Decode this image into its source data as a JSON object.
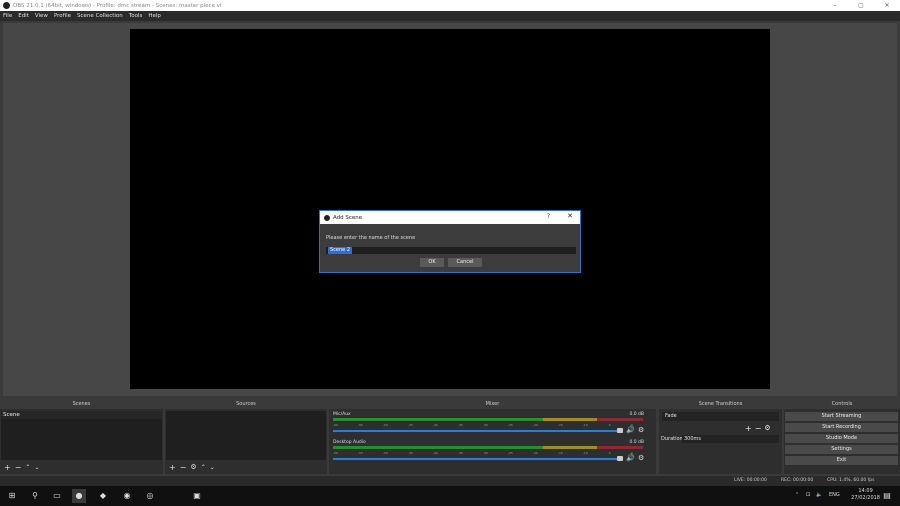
{
  "window": {
    "title": "OBS 21.0.1 (64bit, windows) - Profile: dmc stream - Scenes: master piece vi",
    "min": "–",
    "max": "▢",
    "close": "✕"
  },
  "menu": [
    "File",
    "Edit",
    "View",
    "Profile",
    "Scene Collection",
    "Tools",
    "Help"
  ],
  "dialog": {
    "title": "Add Scene",
    "help": "?",
    "close": "✕",
    "prompt": "Please enter the name of the scene",
    "input_value": "Scene 2",
    "ok": "OK",
    "cancel": "Cancel"
  },
  "docks": {
    "scenes": {
      "header": "Scenes",
      "items": [
        "Scene"
      ]
    },
    "sources": {
      "header": "Sources"
    },
    "mixer": {
      "header": "Mixer",
      "channels": [
        {
          "name": "Mic/Aux",
          "db": "0.0 dB"
        },
        {
          "name": "Desktop Audio",
          "db": "0.0 dB"
        }
      ],
      "ticks": [
        "-60",
        "-55",
        "-50",
        "-45",
        "-40",
        "-35",
        "-30",
        "-25",
        "-20",
        "-15",
        "-10",
        "-5",
        "0"
      ]
    },
    "transitions": {
      "header": "Scene Transitions",
      "selected": "Fade",
      "duration_label": "Duration",
      "duration_value": "300ms"
    },
    "controls": {
      "header": "Controls",
      "buttons": [
        "Start Streaming",
        "Start Recording",
        "Studio Mode",
        "Settings",
        "Exit"
      ]
    }
  },
  "status": {
    "live": "LIVE: 00:00:00",
    "rec": "REC: 00:00:00",
    "cpu": "CPU: 1.4%, 60.00 fps"
  },
  "taskbar": {
    "lang": "ENG",
    "time": "14:09",
    "date": "27/02/2018"
  }
}
